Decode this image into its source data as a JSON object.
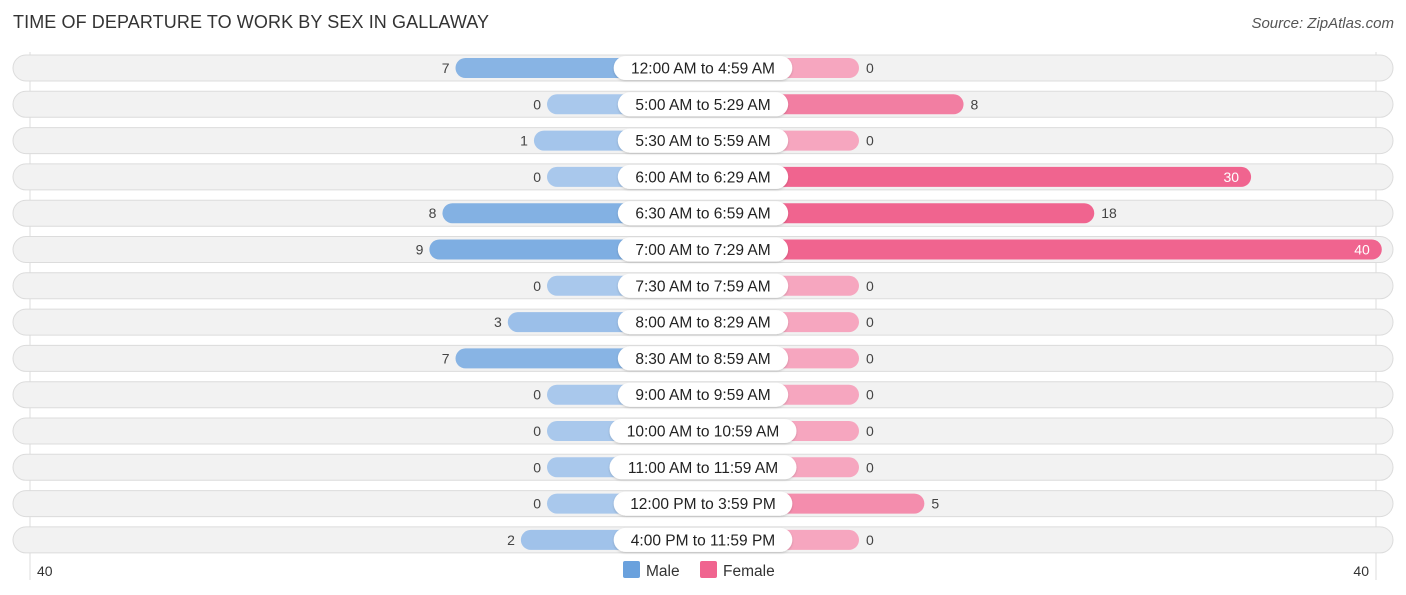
{
  "header": {
    "title": "TIME OF DEPARTURE TO WORK BY SEX IN GALLAWAY",
    "source": "Source: ZipAtlas.com"
  },
  "colors": {
    "male_strong": "#6aa1dd",
    "male_light": "#a9c8ec",
    "female_strong": "#f0648f",
    "female_light": "#f6a6bf",
    "row_bg": "#f2f2f2"
  },
  "chart_data": {
    "type": "bar",
    "orientation": "horizontal-diverging",
    "title": "TIME OF DEPARTURE TO WORK BY SEX IN GALLAWAY",
    "categories": [
      "12:00 AM to 4:59 AM",
      "5:00 AM to 5:29 AM",
      "5:30 AM to 5:59 AM",
      "6:00 AM to 6:29 AM",
      "6:30 AM to 6:59 AM",
      "7:00 AM to 7:29 AM",
      "7:30 AM to 7:59 AM",
      "8:00 AM to 8:29 AM",
      "8:30 AM to 8:59 AM",
      "9:00 AM to 9:59 AM",
      "10:00 AM to 10:59 AM",
      "11:00 AM to 11:59 AM",
      "12:00 PM to 3:59 PM",
      "4:00 PM to 11:59 PM"
    ],
    "series": [
      {
        "name": "Male",
        "values": [
          7,
          0,
          1,
          0,
          8,
          9,
          0,
          3,
          7,
          0,
          0,
          0,
          0,
          2
        ]
      },
      {
        "name": "Female",
        "values": [
          0,
          8,
          0,
          30,
          18,
          40,
          0,
          0,
          0,
          0,
          0,
          0,
          5,
          0
        ]
      }
    ],
    "axis": {
      "left_tick": "40",
      "right_tick": "40",
      "range": [
        -40,
        40
      ]
    },
    "legend": {
      "position": "bottom-center",
      "entries": [
        "Male",
        "Female"
      ]
    },
    "grid": false
  }
}
